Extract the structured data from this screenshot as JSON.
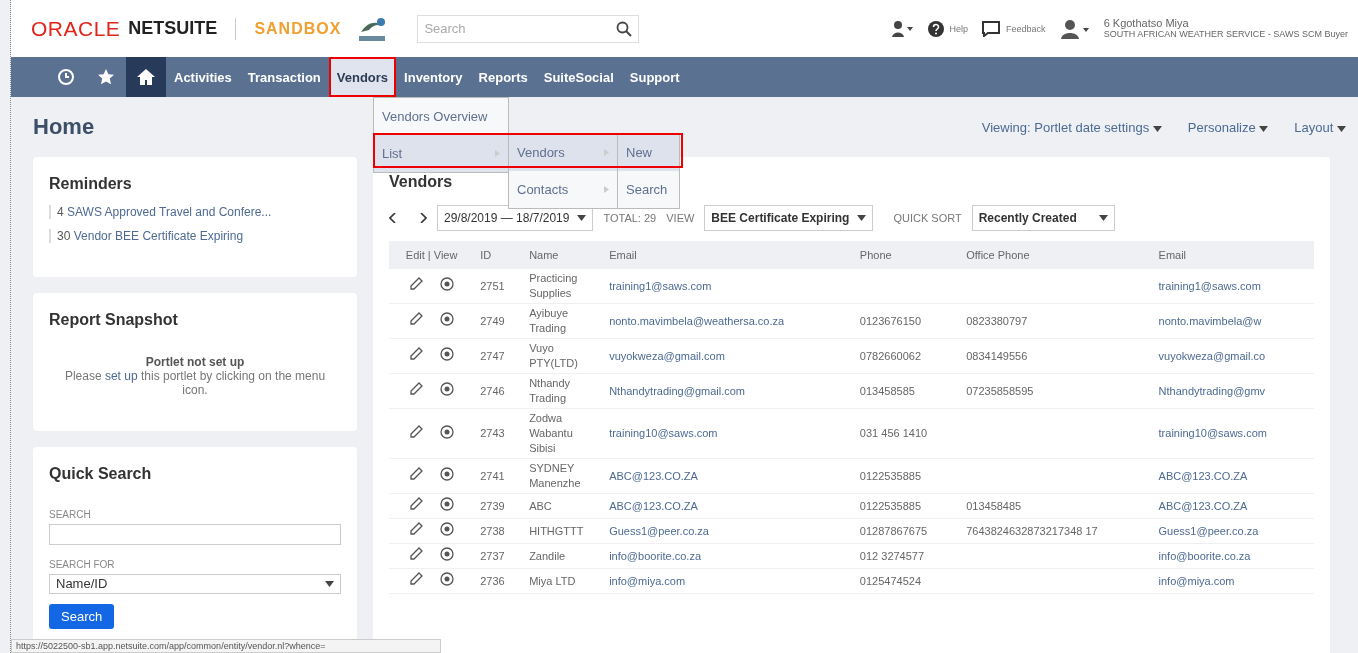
{
  "header": {
    "brand_oracle": "ORACLE",
    "brand_netsuite": "NETSUITE",
    "environment": "SANDBOX",
    "search": {
      "placeholder": "Search"
    },
    "help": "Help",
    "feedback": "Feedback",
    "user_name": "6 Kgothatso Miya",
    "user_role": "SOUTH AFRICAN WEATHER SERVICE - SAWS SCM Buyer"
  },
  "nav": {
    "items": [
      {
        "label": "Activities",
        "selected": false,
        "highlighted": false
      },
      {
        "label": "Transaction",
        "selected": false,
        "highlighted": false
      },
      {
        "label": "Vendors",
        "selected": true,
        "highlighted": true
      },
      {
        "label": "Inventory",
        "selected": false,
        "highlighted": false
      },
      {
        "label": "Reports",
        "selected": false,
        "highlighted": false
      },
      {
        "label": "SuiteSocial",
        "selected": false,
        "highlighted": false
      },
      {
        "label": "Support",
        "selected": false,
        "highlighted": false
      }
    ]
  },
  "menu": {
    "highlighted": true,
    "columns": [
      [
        {
          "label": "Vendors Overview",
          "selected": false,
          "submenu": false
        },
        {
          "label": "List",
          "selected": true,
          "submenu": true
        }
      ],
      [
        {
          "label": "Vendors",
          "selected": true,
          "submenu": true
        },
        {
          "label": "Contacts",
          "selected": false,
          "submenu": true
        }
      ],
      [
        {
          "label": "New",
          "selected": true,
          "submenu": false
        },
        {
          "label": "Search",
          "selected": false,
          "submenu": false
        }
      ]
    ]
  },
  "page": {
    "title": "Home",
    "links": [
      "Viewing: Portlet date settings",
      "Personalize",
      "Layout"
    ]
  },
  "reminders": {
    "title": "Reminders",
    "items": [
      {
        "count": "4",
        "label": "SAWS Approved Travel and Confere..."
      },
      {
        "count": "30",
        "label": "Vendor BEE Certificate Expiring"
      }
    ]
  },
  "report_snapshot": {
    "title": "Report Snapshot",
    "message_title": "Portlet not set up",
    "message_before": "Please",
    "message_link": "set up",
    "message_after": "this portlet by clicking on the menu icon."
  },
  "quick_search": {
    "title": "Quick Search",
    "search_label": "SEARCH",
    "search_for_label": "SEARCH FOR",
    "search_for_value": "Name/ID",
    "button": "Search"
  },
  "vendors": {
    "title": "Vendors",
    "date_range": "29/8/2019 — 18/7/2019",
    "total": "TOTAL: 29",
    "view_label": "VIEW",
    "view_value": "BEE Certificate Expiring",
    "sort_label": "QUICK SORT",
    "sort_value": "Recently Created",
    "actions_header": "Edit | View",
    "columns": [
      "ID",
      "Name",
      "Email",
      "Phone",
      "Office Phone",
      "Email"
    ],
    "rows": [
      [
        "2751",
        "Practicing Supplies",
        "training1@saws.com",
        "",
        "",
        "training1@saws.com"
      ],
      [
        "2749",
        "Ayibuye Trading",
        "nonto.mavimbela@weathersa.co.za",
        "0123676150",
        "0823380797",
        "nonto.mavimbela@w"
      ],
      [
        "2747",
        "Vuyo PTY(LTD)",
        "vuyokweza@gmail.com",
        "0782660062",
        "0834149556",
        "vuyokweza@gmail.co"
      ],
      [
        "2746",
        "Nthandy Trading",
        "Nthandytrading@gmail.com",
        "013458585",
        "07235858595",
        "Nthandytrading@gmv"
      ],
      [
        "2743",
        "Zodwa Wabantu Sibisi",
        "training10@saws.com",
        "031 456 1410",
        "",
        "training10@saws.com"
      ],
      [
        "2741",
        "SYDNEY Manenzhe",
        "ABC@123.CO.ZA",
        "0122535885",
        "",
        "ABC@123.CO.ZA"
      ],
      [
        "2739",
        "ABC",
        "ABC@123.CO.ZA",
        "0122535885",
        "013458485",
        "ABC@123.CO.ZA"
      ],
      [
        "2738",
        "HITHGTTT",
        "Guess1@peer.co.za",
        "01287867675",
        "7643824632873217348 17",
        "Guess1@peer.co.za"
      ],
      [
        "2737",
        "Zandile",
        "info@boorite.co.za",
        "012 3274577",
        "",
        "info@boorite.co.za"
      ],
      [
        "2736",
        "Miya LTD",
        "info@miya.com",
        "0125474524",
        "",
        "info@miya.com"
      ]
    ]
  },
  "status_url": "https://5022500-sb1.app.netsuite.com/app/common/entity/vendor.nl?whence="
}
